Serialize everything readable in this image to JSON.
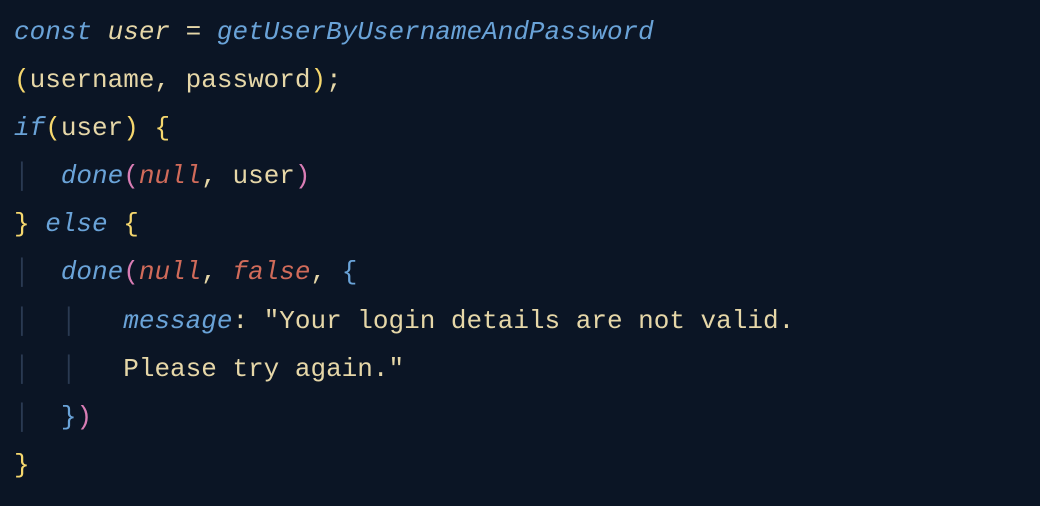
{
  "code": {
    "line1": {
      "const": "const",
      "user": "user",
      "equals": "=",
      "func": "getUserByUsernameAndPassword"
    },
    "line2": {
      "lparen": "(",
      "arg1": "username",
      "comma": ",",
      "arg2": "password",
      "rparen": ")",
      "semi": ";"
    },
    "line3": {
      "if": "if",
      "lparen": "(",
      "user": "user",
      "rparen": ")",
      "lbrace": "{"
    },
    "line4": {
      "guide": "│",
      "indent": "  ",
      "done": "done",
      "lparen": "(",
      "null": "null",
      "comma": ",",
      "user": "user",
      "rparen": ")"
    },
    "line5": {
      "rbrace": "}",
      "else": "else",
      "lbrace": "{"
    },
    "line6": {
      "guide": "│",
      "indent": "  ",
      "done": "done",
      "lparen": "(",
      "null": "null",
      "comma1": ",",
      "false": "false",
      "comma2": ",",
      "lbrace": "{"
    },
    "line7": {
      "guide1": "│",
      "guide2": "│",
      "indent": "   ",
      "prop": "message",
      "colon": ":",
      "string": "\"Your login details are not valid."
    },
    "line8": {
      "guide1": "│",
      "guide2": "│",
      "indent": "   ",
      "string": "Please try again.\""
    },
    "line9": {
      "guide": "│",
      "indent": "  ",
      "rbrace": "}",
      "rparen": ")"
    },
    "line10": {
      "rbrace": "}"
    }
  }
}
